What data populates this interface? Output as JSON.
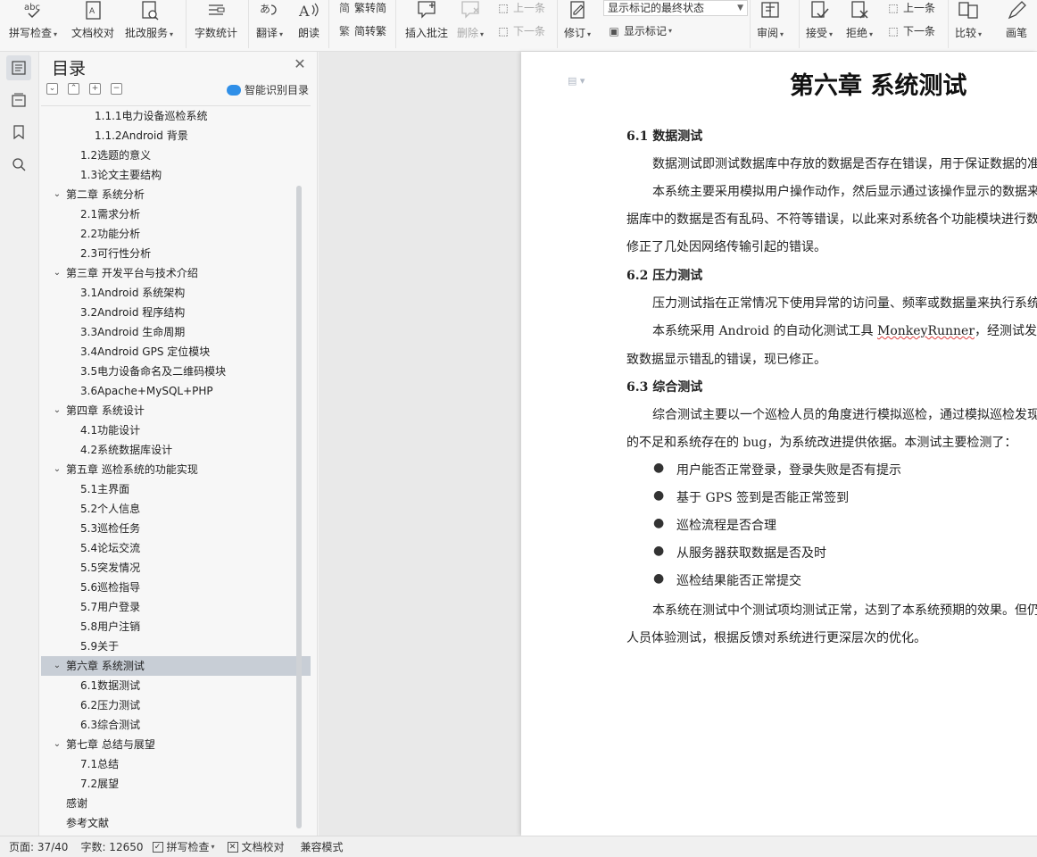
{
  "toolbar": {
    "spell_check": "拼写检查",
    "doc_proof": "文档校对",
    "revise_service": "批改服务",
    "word_count": "字数统计",
    "translate": "翻译",
    "read_aloud": "朗读",
    "to_traditional": "繁转简",
    "to_simplified": "简转繁",
    "insert_comment": "插入批注",
    "delete": "删除",
    "prev_comment": "上一条",
    "next_comment": "下一条",
    "track_changes": "修订",
    "markup_select": "显示标记的最终状态",
    "show_markup": "显示标记",
    "review": "审阅",
    "accept": "接受",
    "reject": "拒绝",
    "prev_change": "上一条",
    "next_change": "下一条",
    "compare": "比较",
    "ink": "画笔",
    "abc": "abc"
  },
  "toc": {
    "title": "目录",
    "smart_label": "智能识别目录",
    "items": [
      {
        "label": "1.1.1电力设备巡检系统",
        "level": 3
      },
      {
        "label": "1.1.2Android 背景",
        "level": 3
      },
      {
        "label": "1.2选题的意义",
        "level": 2
      },
      {
        "label": "1.3论文主要结构",
        "level": 2
      },
      {
        "label": "第二章  系统分析",
        "level": 1
      },
      {
        "label": "2.1需求分析",
        "level": 2
      },
      {
        "label": "2.2功能分析",
        "level": 2
      },
      {
        "label": "2.3可行性分析",
        "level": 2
      },
      {
        "label": "第三章  开发平台与技术介绍",
        "level": 1
      },
      {
        "label": "3.1Android 系统架构",
        "level": 2
      },
      {
        "label": "3.2Android 程序结构",
        "level": 2
      },
      {
        "label": "3.3Android 生命周期",
        "level": 2
      },
      {
        "label": "3.4Android GPS 定位模块",
        "level": 2
      },
      {
        "label": "3.5电力设备命名及二维码模块",
        "level": 2
      },
      {
        "label": "3.6Apache+MySQL+PHP",
        "level": 2
      },
      {
        "label": "第四章  系统设计",
        "level": 1
      },
      {
        "label": "4.1功能设计",
        "level": 2
      },
      {
        "label": "4.2系统数据库设计",
        "level": 2
      },
      {
        "label": "第五章  巡检系统的功能实现",
        "level": 1
      },
      {
        "label": "5.1主界面",
        "level": 2
      },
      {
        "label": "5.2个人信息",
        "level": 2
      },
      {
        "label": "5.3巡检任务",
        "level": 2
      },
      {
        "label": "5.4论坛交流",
        "level": 2
      },
      {
        "label": "5.5突发情况",
        "level": 2
      },
      {
        "label": "5.6巡检指导",
        "level": 2
      },
      {
        "label": "5.7用户登录",
        "level": 2
      },
      {
        "label": "5.8用户注销",
        "level": 2
      },
      {
        "label": "5.9关于",
        "level": 2
      },
      {
        "label": "第六章  系统测试",
        "level": 1,
        "selected": true
      },
      {
        "label": "6.1数据测试",
        "level": 2
      },
      {
        "label": "6.2压力测试",
        "level": 2
      },
      {
        "label": "6.3综合测试",
        "level": 2
      },
      {
        "label": "第七章  总结与展望",
        "level": 1
      },
      {
        "label": "7.1总结",
        "level": 2
      },
      {
        "label": "7.2展望",
        "level": 2
      },
      {
        "label": "感谢",
        "level": 0
      },
      {
        "label": "参考文献",
        "level": 0
      }
    ]
  },
  "document": {
    "chapter_title": "第六章  系统测试",
    "s61_heading": "6.1  数据测试",
    "s61_p1": "数据测试即测试数据库中存放的数据是否存在错误，用于保证数据的准",
    "s61_p2a": "本系统主要采用模拟用户操作动作，然后显示通过该操作显示的数据来",
    "s61_p2b": "据库中的数据是否有乱码、不符等错误，以此来对系统各个功能模块进行数",
    "s61_p2c": "修正了几处因网络传输引起的错误。",
    "s62_heading": "6.2  压力测试",
    "s62_p1": "压力测试指在正常情况下使用异常的访问量、频率或数据量来执行系统",
    "s62_p2a_pre": "本系统采用 Android 的自动化测试工具 ",
    "s62_p2a_word": "MonkeyRunner",
    "s62_p2a_post": "，经测试发现几",
    "s62_p2b": "致数据显示错乱的错误，现已修正。",
    "s63_heading": "6.3  综合测试",
    "s63_p1a": "综合测试主要以一个巡检人员的角度进行模拟巡检，通过模拟巡检发现",
    "s63_p1b": "的不足和系统存在的 bug，为系统改进提供依据。本测试主要检测了：",
    "bullets": [
      "用户能否正常登录，登录失败是否有提示",
      "基于 GPS 签到是否能正常签到",
      "巡检流程是否合理",
      "从服务器获取数据是否及时",
      "巡检结果能否正常提交"
    ],
    "s63_p2a": "本系统在测试中个测试项均测试正常，达到了本系统预期的效果。但仍",
    "s63_p2b": "人员体验测试，根据反馈对系统进行更深层次的优化。"
  },
  "status": {
    "page": "页面: 37/40",
    "words": "字数: 12650",
    "spell": "拼写检查",
    "proof": "文档校对",
    "compat": "兼容模式"
  },
  "colors": {
    "selected_row": "#c8ced6",
    "accent": "#2f8fe8",
    "page": "#ffffff"
  }
}
